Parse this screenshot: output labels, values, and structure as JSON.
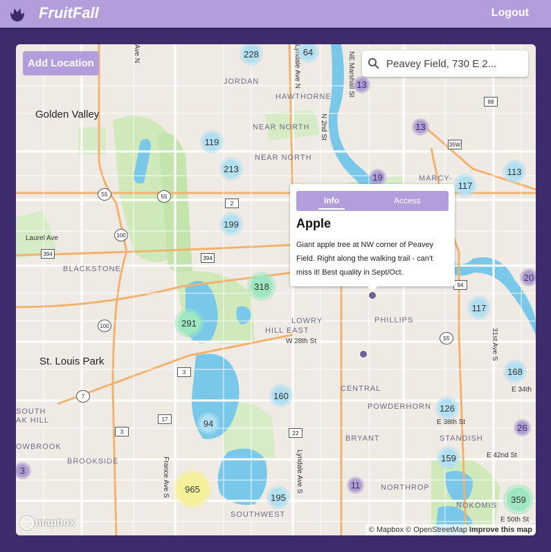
{
  "header": {
    "brand": "FruitFall",
    "logout_label": "Logout",
    "colors": {
      "header_bg": "#b39ddb",
      "page_bg": "#3d2b6b"
    }
  },
  "map": {
    "add_location_label": "Add Location",
    "search": {
      "value": "Peavey Field, 730 E 2..."
    },
    "places": {
      "jordan": "JORDAN",
      "hawthorne": "HAWTHORNE",
      "near_north": "NEAR NORTH",
      "near_north2": "NEAR NORTH",
      "golden_valley": "Golden Valley",
      "marcy": "MARCY-",
      "laurel_ave": "Laurel Ave",
      "blackstone": "BLACKSTONE",
      "lowry_hill_east": "LOWRY",
      "lowry_hill_east2": "HILL EAST",
      "phillips": "PHILLIPS",
      "w28th": "W 28th St",
      "st_louis_park": "St. Louis Park",
      "central": "CENTRAL",
      "powderhorn": "POWDERHORN",
      "south_oak_hill": "SOUTH",
      "south_oak_hill2": "AK HILL",
      "owbrook": "OWBROOK",
      "brookside": "BROOKSIDE",
      "bryant": "BRYANT",
      "standish": "STANDISH",
      "e38th": "E 38th St",
      "e42nd": "E 42nd St",
      "e34th": "E 34th",
      "northrop": "NORTHROP",
      "nokomis": "NOKOMIS",
      "e50th": "E 50th St",
      "southwest": "SOUTHWEST",
      "n2nd": "N 2nd St",
      "nmarshall": "NE Marshall St",
      "lyndale_n": "Lyndale Ave N",
      "ave_n": "Ave N",
      "france": "France Ave S",
      "lyndale_s": "Lyndale Ave S",
      "ave31": "31st Ave S"
    },
    "clusters": [
      {
        "label": "228"
      },
      {
        "label": "64"
      },
      {
        "label": "13"
      },
      {
        "label": "13"
      },
      {
        "label": "119"
      },
      {
        "label": "213"
      },
      {
        "label": "19"
      },
      {
        "label": "117"
      },
      {
        "label": "113"
      },
      {
        "label": "199"
      },
      {
        "label": "318"
      },
      {
        "label": "291"
      },
      {
        "label": "20"
      },
      {
        "label": "117"
      },
      {
        "label": "168"
      },
      {
        "label": "160"
      },
      {
        "label": "126"
      },
      {
        "label": "94"
      },
      {
        "label": "26"
      },
      {
        "label": "159"
      },
      {
        "label": "3"
      },
      {
        "label": "965"
      },
      {
        "label": "11"
      },
      {
        "label": "195"
      },
      {
        "label": "359"
      }
    ],
    "highways": {
      "h88": "88",
      "h35w": "35W",
      "h55a": "55",
      "h55b": "55",
      "h2": "2",
      "h100a": "100",
      "h394a": "394",
      "h394b": "394",
      "h100b": "100",
      "h55c": "55",
      "h3": "3",
      "h7": "7",
      "h17": "17",
      "h3b": "3",
      "h22": "22",
      "h94": "94"
    },
    "popup": {
      "tab_info": "Info",
      "tab_access": "Access",
      "title": "Apple",
      "description": "Giant apple tree at NW corner of Peavey Field. Right along the walking trail - can't miss it! Best quality in Sept/Oct."
    },
    "mapbox_logo": "mapbox",
    "attribution": {
      "mapbox": "© Mapbox",
      "osm": "© OpenStreetMap",
      "improve": "Improve this map"
    }
  }
}
